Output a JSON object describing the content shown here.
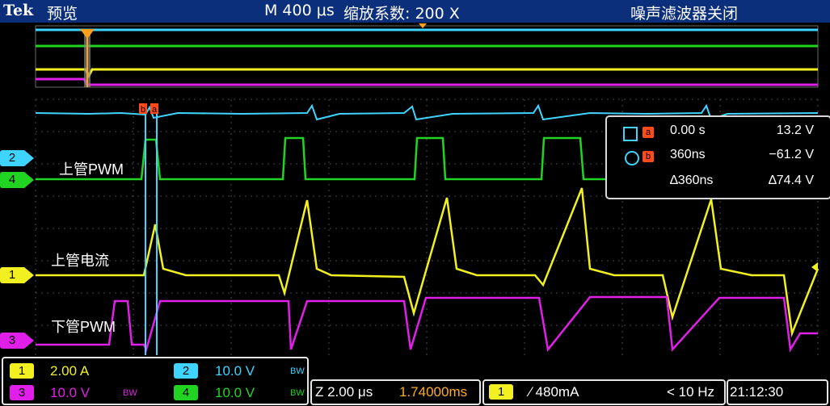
{
  "header": {
    "brand": "Tek",
    "mode": "预览",
    "timebase": "M 400 μs",
    "zoom_factor": "缩放系数: 200 X",
    "noise_filter": "噪声滤波器关闭"
  },
  "channel_markers": {
    "ch2": "2",
    "ch4": "4",
    "ch1": "1",
    "ch3": "3"
  },
  "signal_labels": {
    "upper_pwm": "上管PWM",
    "upper_current": "上管电流",
    "lower_pwm": "下管PWM"
  },
  "cursor_tags": {
    "a": "a",
    "b": "b"
  },
  "measurements": {
    "a_time": "0.00 s",
    "a_value": "13.2 V",
    "b_time": "360ns",
    "b_value": "−61.2 V",
    "delta_time": "∆360ns",
    "delta_value": "∆74.4 V"
  },
  "channels": {
    "ch1": {
      "badge": "1",
      "scale": "2.00 A"
    },
    "ch2": {
      "badge": "2",
      "scale": "10.0 V",
      "bw": "BW"
    },
    "ch3": {
      "badge": "3",
      "scale": "10.0 V",
      "bw": "BW"
    },
    "ch4": {
      "badge": "4",
      "scale": "10.0 V",
      "bw": "BW"
    }
  },
  "zoom": {
    "scale": "Z 2.00 μs",
    "position": "1.74000ms"
  },
  "trigger": {
    "source": "1",
    "level": "⁄ 480mA",
    "frequency": "< 10 Hz"
  },
  "clock": "21:12:30",
  "colors": {
    "ch1": "#f2f020",
    "ch2": "#3fd4ff",
    "ch3": "#e020e8",
    "ch4": "#22d422",
    "zoom_position": "#ffae21",
    "header_bg": "#0b2f7a"
  }
}
